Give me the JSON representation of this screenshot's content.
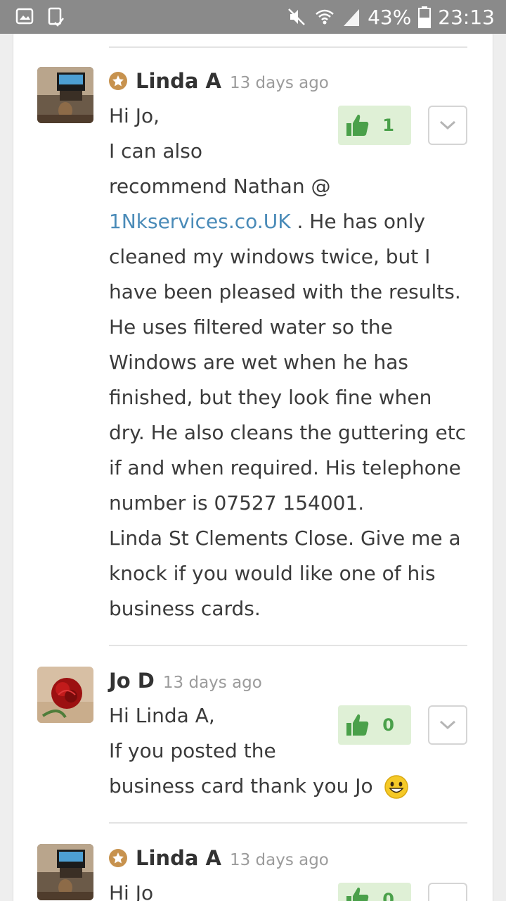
{
  "status_bar": {
    "battery": "43%",
    "time": "23:13",
    "icons": [
      "gallery-icon",
      "screen-cast-icon",
      "mute-icon",
      "wifi-icon",
      "signal-icon",
      "battery-icon"
    ]
  },
  "colors": {
    "accent_link": "#4a8bb8",
    "like_bg": "#dff0d6",
    "like_fg": "#4aa04a",
    "badge": "#c7924e"
  },
  "comments": [
    {
      "author": "Linda A",
      "time": "13 days ago",
      "likes": "1",
      "lines": [
        "Hi Jo,",
        "I can also",
        "recommend Nathan @",
        "__LINK__",
        "cleaned my windows twice, but I",
        "have been pleased with the results.",
        "He uses filtered water so the",
        "Windows are wet when he has",
        "finished, but they look fine when",
        "dry. He also cleans the guttering etc",
        "if and when required. His telephone",
        "number is 07527 154001.",
        "Linda St Clements Close. Give me a",
        "knock if you would like one of his",
        "business cards."
      ],
      "link_text": "1Nkservices.co.UK",
      "link_suffix": " . He has only"
    },
    {
      "author": "Jo D",
      "time": "13 days ago",
      "likes": "0",
      "lines": [
        "Hi Linda A,",
        "If you posted the",
        "business card thank you Jo"
      ]
    },
    {
      "author": "Linda A",
      "time": "13 days ago",
      "likes": "0",
      "lines": [
        "Hi Jo"
      ]
    }
  ]
}
